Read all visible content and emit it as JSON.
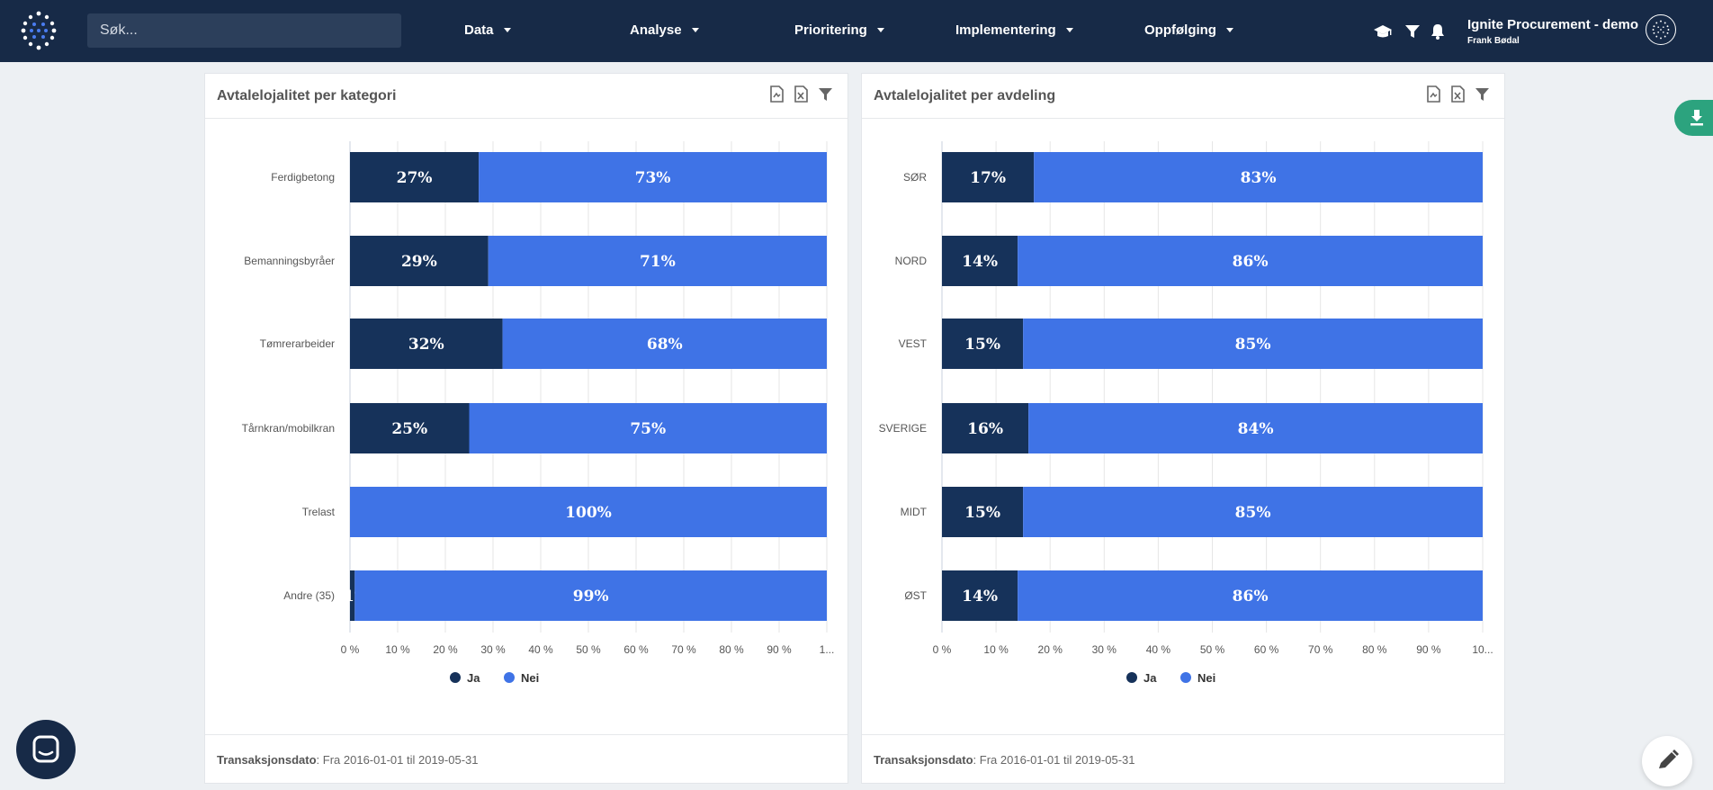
{
  "nav": {
    "search_placeholder": "Søk...",
    "menu": [
      {
        "label": "Data"
      },
      {
        "label": "Analyse"
      },
      {
        "label": "Prioritering"
      },
      {
        "label": "Implementering"
      },
      {
        "label": "Oppfølging"
      }
    ],
    "icons": [
      "graduation-cap-icon",
      "filter-icon",
      "bell-icon"
    ],
    "user": {
      "company": "Ignite Procurement - demo",
      "name": "Frank Bødal"
    }
  },
  "colors": {
    "navbar": "#172a47",
    "ja": "#16325a",
    "nei": "#3f73e6",
    "accent_green": "#2ca37e"
  },
  "cards": [
    {
      "title": "Avtalelojalitet per kategori",
      "footer_label": "Transaksjonsdato",
      "footer_value": ": Fra 2016-01-01 til 2019-05-31"
    },
    {
      "title": "Avtalelojalitet per avdeling",
      "footer_label": "Transaksjonsdato",
      "footer_value": ": Fra 2016-01-01 til 2019-05-31"
    }
  ],
  "chart_data": [
    {
      "type": "bar",
      "orientation": "horizontal",
      "stacked": true,
      "title": "Avtalelojalitet per kategori",
      "categories": [
        "Ferdigbetong",
        "Bemanningsbyråer",
        "Tømrerarbeider",
        "Tårnkran/mobilkran",
        "Trelast",
        "Andre (35)"
      ],
      "series": [
        {
          "name": "Ja",
          "color": "#16325a",
          "values": [
            27,
            29,
            32,
            25,
            0,
            1
          ]
        },
        {
          "name": "Nei",
          "color": "#3f73e6",
          "values": [
            73,
            71,
            68,
            75,
            100,
            99
          ]
        }
      ],
      "x_ticks": [
        "0 %",
        "10 %",
        "20 %",
        "30 %",
        "40 %",
        "50 %",
        "60 %",
        "70 %",
        "80 %",
        "90 %",
        "1..."
      ],
      "xlim": [
        0,
        100
      ],
      "grid": true,
      "legend": "bottom"
    },
    {
      "type": "bar",
      "orientation": "horizontal",
      "stacked": true,
      "title": "Avtalelojalitet per avdeling",
      "categories": [
        "SØR",
        "NORD",
        "VEST",
        "SVERIGE",
        "MIDT",
        "ØST"
      ],
      "series": [
        {
          "name": "Ja",
          "color": "#16325a",
          "values": [
            17,
            14,
            15,
            16,
            15,
            14
          ]
        },
        {
          "name": "Nei",
          "color": "#3f73e6",
          "values": [
            83,
            86,
            85,
            84,
            85,
            86
          ]
        }
      ],
      "x_ticks": [
        "0 %",
        "10 %",
        "20 %",
        "30 %",
        "40 %",
        "50 %",
        "60 %",
        "70 %",
        "80 %",
        "90 %",
        "10..."
      ],
      "xlim": [
        0,
        100
      ],
      "grid": true,
      "legend": "bottom"
    }
  ]
}
